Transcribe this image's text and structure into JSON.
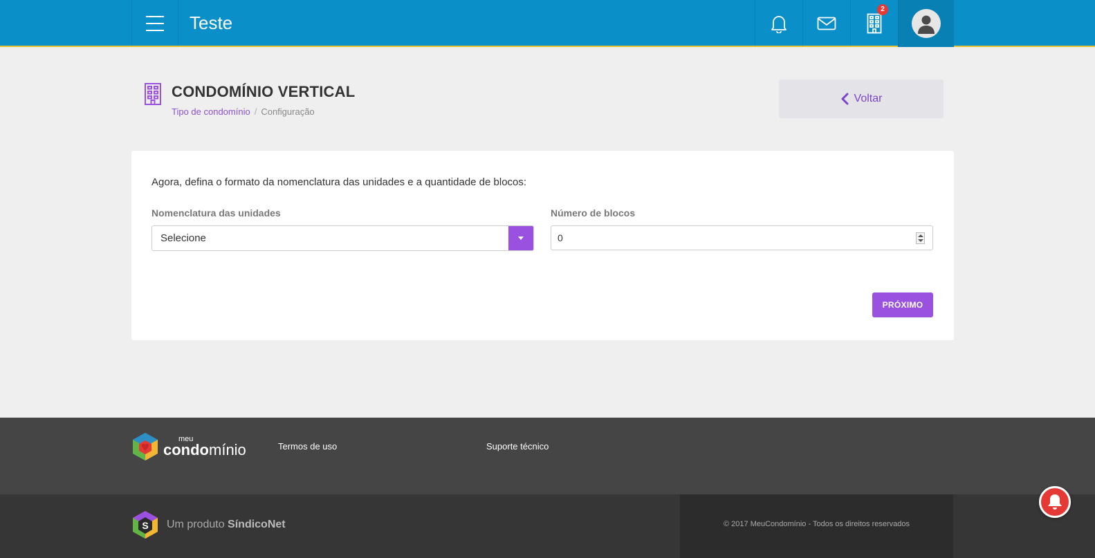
{
  "header": {
    "title": "Teste",
    "buildings_badge": "2",
    "icons": {
      "menu": "menu-icon",
      "bell": "bell-icon",
      "mail": "mail-icon",
      "buildings": "building-icon",
      "avatar": "user-icon"
    },
    "colors": {
      "bar": "#0a8fc9",
      "accent_line": "#e8c133",
      "badge": "#e53935"
    }
  },
  "page": {
    "title": "CONDOMÍNIO VERTICAL",
    "icon": "building-icon",
    "breadcrumb": [
      "Tipo de condomínio",
      "Configuração"
    ],
    "breadcrumb_sep": "/",
    "back_label": "Voltar"
  },
  "form": {
    "intro": "Agora, defina o formato da nomenclatura das unidades e a quantidade de blocos:",
    "nomenclatura_label": "Nomenclatura das unidades",
    "nomenclatura_value": "Selecione",
    "blocos_label": "Número de blocos",
    "blocos_value": "0",
    "next_label": "PRÓXIMO",
    "accent_color": "#9b51e0"
  },
  "footer": {
    "logo_meu": "meu",
    "logo_cond_a": "condo",
    "logo_cond_b": "mínio",
    "terms": "Termos de uso",
    "support": "Suporte técnico",
    "product_prefix": "Um produto",
    "product_name": "SíndicoNet",
    "copyright": "© 2017 MeuCondomínio - Todos os direitos reservados"
  }
}
